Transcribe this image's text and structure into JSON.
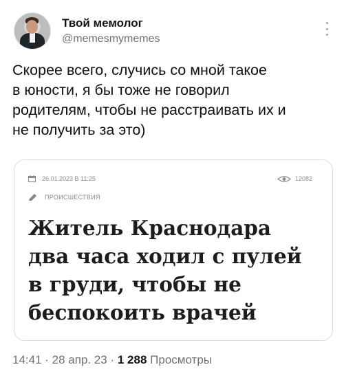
{
  "author": {
    "display_name": "Твой мемолог",
    "handle": "@memesmymemes"
  },
  "tweet": {
    "lines": [
      "Скорее всего, случись со мной такое",
      "в юности, я бы тоже не говорил",
      "родителям, чтобы не расстраивать их и",
      "не получить за это)"
    ]
  },
  "card": {
    "date": "26.01.2023 В 11:25",
    "views": "12082",
    "category": "ПРОИСШЕСТВИЯ",
    "headline_lines": [
      "Житель Краснодара",
      "два часа ходил с пулей",
      "в груди, чтобы не",
      "беспокоить врачей"
    ]
  },
  "footer": {
    "time": "14:41",
    "sep1": " · ",
    "date": "28 апр. 23",
    "sep2": " · ",
    "views_count": "1 288",
    "views_label": " Просмотры"
  },
  "icons": {
    "more": "more-vertical-icon",
    "calendar": "calendar-icon",
    "eye": "eye-icon",
    "pen": "pen-icon"
  }
}
